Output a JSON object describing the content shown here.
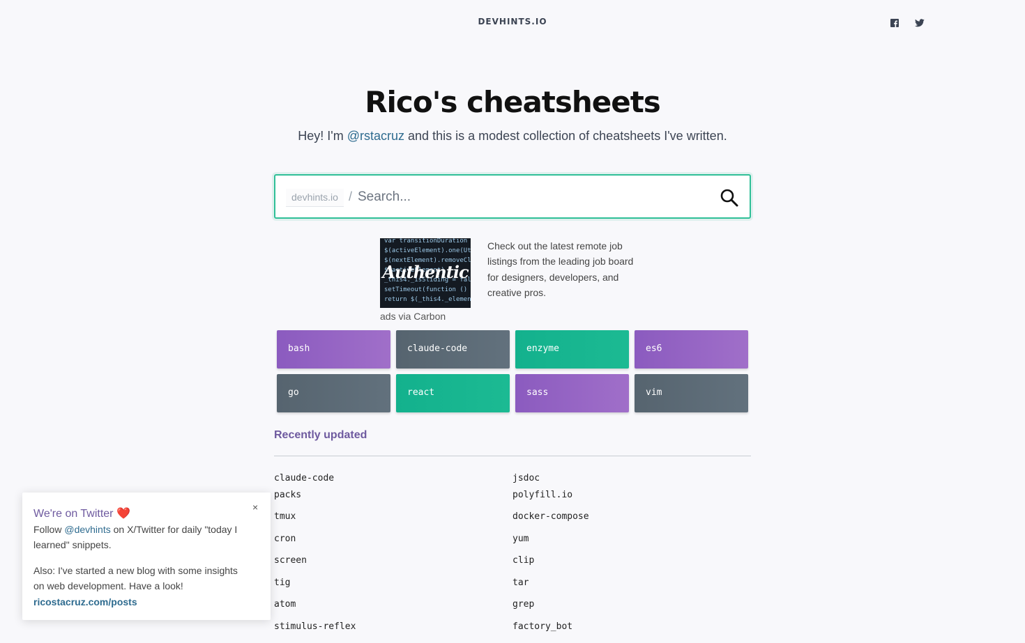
{
  "header": {
    "brand": "DEVHINTS.IO",
    "social": [
      {
        "name": "facebook-icon"
      },
      {
        "name": "twitter-icon"
      }
    ]
  },
  "hero": {
    "title": "Rico's cheatsheets",
    "subtitle_pre": "Hey! I'm ",
    "subtitle_link": "@rstacruz",
    "subtitle_post": " and this is a modest collection of cheatsheets I've written."
  },
  "search": {
    "prefix": "devhints.io",
    "separator": "/",
    "placeholder": "Search...",
    "value": ""
  },
  "ad": {
    "image_logo_text": "Authentic",
    "text": "Check out the latest remote job listings from the leading job board for designers, developers, and creative pros.",
    "via": "ads via Carbon"
  },
  "tiles": [
    {
      "label": "bash",
      "color": "purple"
    },
    {
      "label": "claude-code",
      "color": "gray"
    },
    {
      "label": "enzyme",
      "color": "green"
    },
    {
      "label": "es6",
      "color": "purple"
    },
    {
      "label": "go",
      "color": "gray"
    },
    {
      "label": "react",
      "color": "green"
    },
    {
      "label": "sass",
      "color": "purple"
    },
    {
      "label": "vim",
      "color": "gray"
    }
  ],
  "recent": {
    "title": "Recently updated",
    "col1": [
      "claude-code",
      "packs",
      "tmux",
      "cron",
      "screen",
      "tig",
      "atom",
      "stimulus-reflex"
    ],
    "col2": [
      "jsdoc",
      "polyfill.io",
      "docker-compose",
      "yum",
      "clip",
      "tar",
      "grep",
      "factory_bot"
    ]
  },
  "popup": {
    "title": "We're on Twitter",
    "heart": "❤️",
    "close": "×",
    "line1_pre": "Follow ",
    "line1_link": "@devhints",
    "line1_post": " on X/Twitter for daily \"today I learned\" snippets.",
    "line2": "Also: I've started a new blog with some insights on web development. Have a look!",
    "blog_link": "ricostacruz.com/posts"
  },
  "colors": {
    "accent_green": "#2fbf97",
    "purple": "#8b5bbf",
    "gray": "#56646f",
    "link": "#2e6b8f"
  }
}
